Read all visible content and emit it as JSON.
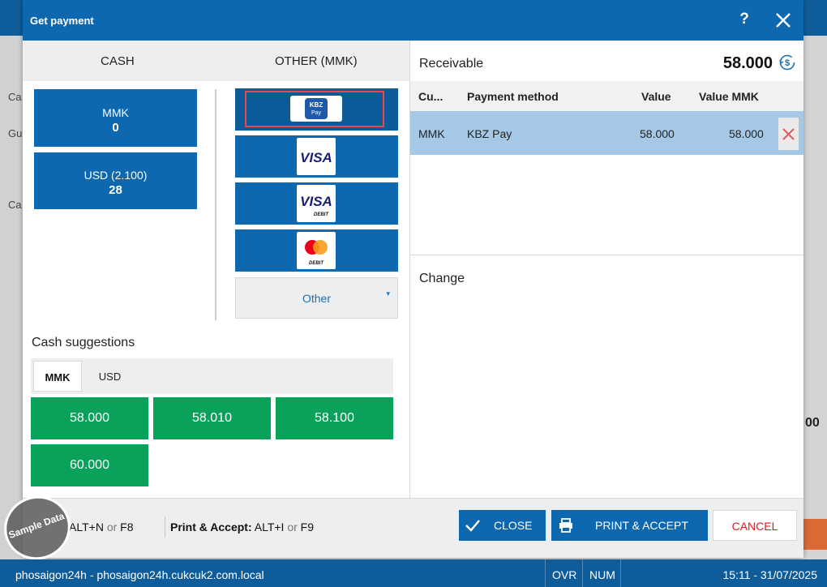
{
  "dialog": {
    "title": "Get payment",
    "help_label": "?"
  },
  "tabs": {
    "cash": "CASH",
    "other": "OTHER (MMK)"
  },
  "cash_buttons": [
    {
      "currency": "MMK",
      "amount": "0"
    },
    {
      "currency": "USD (2.100)",
      "amount": "28"
    }
  ],
  "payment_methods": [
    {
      "name": "KBZ Pay",
      "logo_line1": "KBZ",
      "logo_line2": "Pay",
      "selected": true
    },
    {
      "name": "VISA",
      "logo_line1": "VISA"
    },
    {
      "name": "VISA Debit",
      "logo_line1": "VISA",
      "logo_line2": "DEBIT"
    },
    {
      "name": "Mastercard Debit",
      "logo_line2": "DEBIT"
    }
  ],
  "other_method": {
    "label": "Other",
    "caret": "▾"
  },
  "cash_suggestions": {
    "title": "Cash suggestions",
    "tabs": [
      "MMK",
      "USD"
    ],
    "active_tab": "MMK",
    "amounts": [
      "58.000",
      "58.010",
      "58.100",
      "60.000"
    ]
  },
  "receivable": {
    "label": "Receivable",
    "value": "58.000"
  },
  "table": {
    "headers": [
      "Cu...",
      "Payment method",
      "Value",
      "Value MMK"
    ],
    "rows": [
      {
        "currency": "MMK",
        "method": "KBZ Pay",
        "value": "58.000",
        "value_mmk": "58.000"
      }
    ]
  },
  "change": {
    "label": "Change"
  },
  "footer": {
    "shortcut1_keys": "ALT+N",
    "shortcut1_or": "or",
    "shortcut1_fkey": "F8",
    "shortcut2_label": "Print & Accept:",
    "shortcut2_keys": "ALT+I",
    "shortcut2_or": "or",
    "shortcut2_fkey": "F9",
    "close_label": "CLOSE",
    "print_label": "PRINT & ACCEPT",
    "cancel_label": "CANCEL"
  },
  "watermark": {
    "text": "Sample Data"
  },
  "status_bar": {
    "host": "phosaigon24h - phosaigon24h.cukcuk2.com.local",
    "ovr": "OVR",
    "num": "NUM",
    "datetime": "15:11 - 31/07/2025"
  },
  "background": {
    "labels": [
      "Ca",
      "Gu",
      "Ca",
      "00"
    ]
  },
  "colors": {
    "primary": "#0e68b0",
    "selected_row": "#a5c8e6",
    "suggestion_green": "#0aa15a",
    "cancel_red": "#d91b23",
    "highlight_outline": "#e8474b"
  }
}
